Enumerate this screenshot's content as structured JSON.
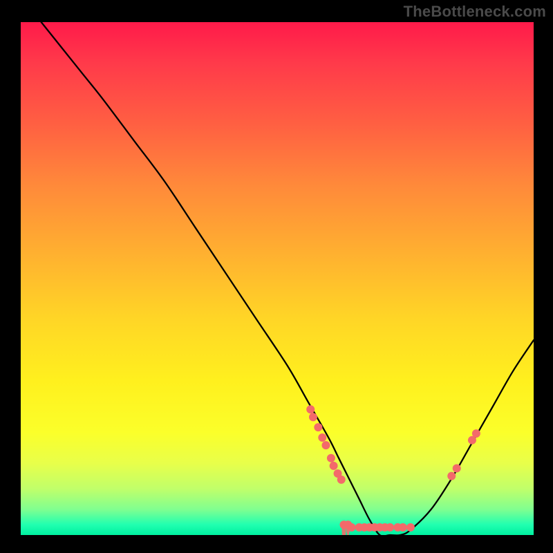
{
  "watermark": "TheBottleneck.com",
  "chart_data": {
    "type": "line",
    "title": "",
    "xlabel": "",
    "ylabel": "",
    "xlim": [
      0,
      100
    ],
    "ylim": [
      0,
      100
    ],
    "grid": false,
    "legend": false,
    "description": "V-shaped bottleneck curve on red-yellow-green vertical gradient. Minimum near x≈70. Left branch starts near top-left and descends steeply; right branch rises toward upper-right.",
    "series": [
      {
        "name": "curve",
        "color": "#000000",
        "x": [
          4,
          8,
          12,
          16,
          22,
          28,
          34,
          40,
          46,
          52,
          56,
          60,
          62,
          64,
          66,
          68,
          70,
          72,
          74,
          76,
          80,
          84,
          88,
          92,
          96,
          100
        ],
        "y": [
          100,
          95,
          90,
          85,
          77,
          69,
          60,
          51,
          42,
          33,
          26,
          19,
          15,
          11,
          7,
          3,
          0,
          0,
          0,
          1,
          5,
          11,
          18,
          25,
          32,
          38
        ]
      }
    ],
    "markers": [
      {
        "x": 56.5,
        "y": 24.5,
        "r": 6
      },
      {
        "x": 57.0,
        "y": 23.0,
        "r": 6
      },
      {
        "x": 58.0,
        "y": 21.0,
        "r": 6
      },
      {
        "x": 58.8,
        "y": 19.0,
        "r": 6
      },
      {
        "x": 59.5,
        "y": 17.5,
        "r": 6
      },
      {
        "x": 60.5,
        "y": 15.0,
        "r": 6
      },
      {
        "x": 61.0,
        "y": 13.5,
        "r": 6
      },
      {
        "x": 61.8,
        "y": 12.0,
        "r": 6
      },
      {
        "x": 62.5,
        "y": 10.8,
        "r": 6
      },
      {
        "x": 63.0,
        "y": 2.0,
        "r": 6,
        "drip": true,
        "drip_len": 35
      },
      {
        "x": 63.8,
        "y": 2.0,
        "r": 6,
        "drip": true,
        "drip_len": 18
      },
      {
        "x": 64.5,
        "y": 1.5,
        "r": 6
      },
      {
        "x": 66.0,
        "y": 1.5,
        "r": 6
      },
      {
        "x": 67.0,
        "y": 1.5,
        "r": 6
      },
      {
        "x": 68.0,
        "y": 1.5,
        "r": 6
      },
      {
        "x": 69.0,
        "y": 1.5,
        "r": 6
      },
      {
        "x": 70.0,
        "y": 1.5,
        "r": 6
      },
      {
        "x": 71.0,
        "y": 1.5,
        "r": 6
      },
      {
        "x": 72.0,
        "y": 1.5,
        "r": 6
      },
      {
        "x": 73.5,
        "y": 1.5,
        "r": 6
      },
      {
        "x": 74.5,
        "y": 1.5,
        "r": 6
      },
      {
        "x": 76.0,
        "y": 1.5,
        "r": 6
      },
      {
        "x": 84.0,
        "y": 11.5,
        "r": 6
      },
      {
        "x": 85.0,
        "y": 13.0,
        "r": 6
      },
      {
        "x": 88.0,
        "y": 18.5,
        "r": 6
      },
      {
        "x": 88.8,
        "y": 19.8,
        "r": 6
      }
    ],
    "marker_color": "#f36a6a",
    "gradient_stops": [
      {
        "pos": 0,
        "color": "#ff1a4a"
      },
      {
        "pos": 20,
        "color": "#ff6042"
      },
      {
        "pos": 45,
        "color": "#ffb030"
      },
      {
        "pos": 70,
        "color": "#fff01e"
      },
      {
        "pos": 90,
        "color": "#c0ff6a"
      },
      {
        "pos": 100,
        "color": "#00f0a0"
      }
    ]
  }
}
